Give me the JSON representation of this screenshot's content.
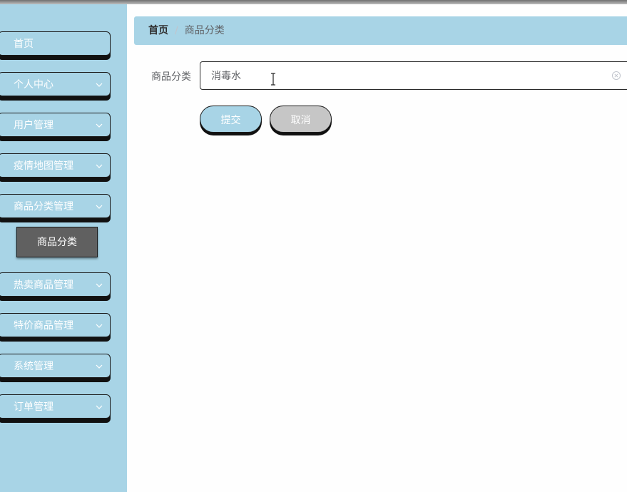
{
  "sidebar": {
    "items": [
      {
        "label": "首页",
        "has_chevron": false
      },
      {
        "label": "个人中心",
        "has_chevron": true
      },
      {
        "label": "用户管理",
        "has_chevron": true
      },
      {
        "label": "疫情地图管理",
        "has_chevron": true
      },
      {
        "label": "商品分类管理",
        "has_chevron": true,
        "expanded": true
      },
      {
        "label": "热卖商品管理",
        "has_chevron": true
      },
      {
        "label": "特价商品管理",
        "has_chevron": true
      },
      {
        "label": "系统管理",
        "has_chevron": true
      },
      {
        "label": "订单管理",
        "has_chevron": true
      }
    ],
    "submenu": {
      "label": "商品分类"
    }
  },
  "breadcrumb": {
    "home": "首页",
    "separator": "/",
    "current": "商品分类"
  },
  "form": {
    "label": "商品分类",
    "value": "消毒水",
    "submit_label": "提交",
    "cancel_label": "取消"
  },
  "colors": {
    "accent": "#a8d4e6",
    "submenu_active": "#606060",
    "cancel": "#c6c6c6"
  },
  "icons": {
    "chevron": "chevron-down-icon",
    "clear": "circle-close-icon",
    "cursor": "text-cursor-icon"
  }
}
